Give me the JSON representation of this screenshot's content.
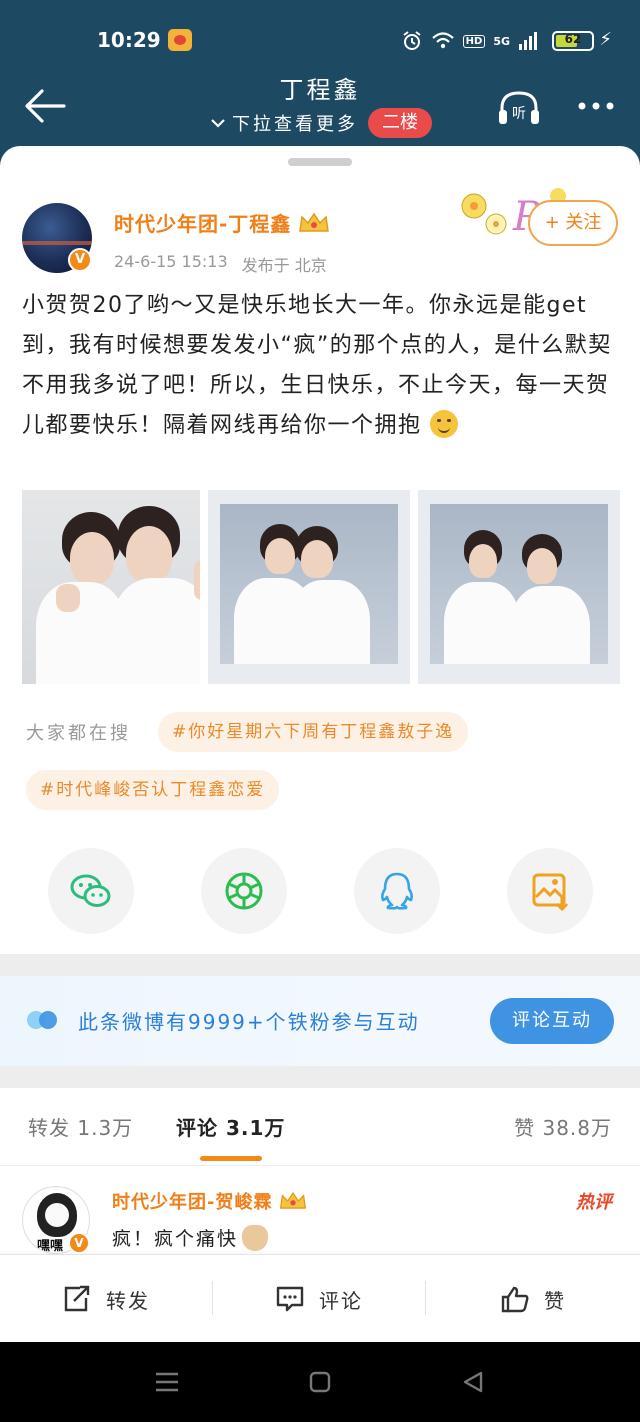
{
  "status_bar": {
    "time": "10:29",
    "battery": "62",
    "battery_level": 0.62,
    "network": "5G",
    "hd": "HD"
  },
  "header": {
    "title": "丁程鑫",
    "subtitle": "下拉查看更多",
    "floor_badge": "二楼"
  },
  "post": {
    "author": "时代少年团-丁程鑫",
    "verified": "V",
    "date": "24-6-15 15:13",
    "location": "发布于 北京",
    "follow_label": "+ 关注",
    "text": "小贺贺20了哟～又是快乐地长大一年。你永远是能get到，我有时候想要发发小“疯”的那个点的人，是什么默契不用我多说了吧！所以，生日快乐，不止今天，每一天贺儿都要快乐！隔着网线再给你一个拥抱"
  },
  "search": {
    "label": "大家都在搜",
    "tags": [
      "#你好星期六下周有丁程鑫敖子逸",
      "#时代峰峻否认丁程鑫恋爱"
    ]
  },
  "share": {
    "items": [
      "wechat-icon",
      "moments-icon",
      "qq-icon",
      "save-image-icon"
    ]
  },
  "fans_banner": {
    "text": "此条微博有9999+个铁粉参与互动",
    "button": "评论互动"
  },
  "tabs": {
    "repost": "转发 1.3万",
    "comment": "评论 3.1万",
    "like": "赞 38.8万"
  },
  "comment": {
    "author": "时代少年团-贺峻霖",
    "avatar_text": "嘿嘿",
    "verified": "V",
    "text": "疯！疯个痛快",
    "badge": "热评"
  },
  "actions": {
    "repost": "转发",
    "comment": "评论",
    "like": "赞"
  },
  "colors": {
    "header_bg": "#1e4962",
    "accent_orange": "#f07f17",
    "badge_red": "#e94a4a",
    "link_blue": "#3f93e2"
  }
}
